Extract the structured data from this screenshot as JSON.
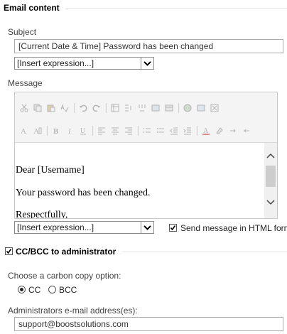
{
  "email_content": {
    "heading": "Email content",
    "subject_label": "Subject",
    "subject_value": "[Current Date & Time] Password has been changed",
    "subject_expression": "[Insert expression...]",
    "message_label": "Message",
    "toolbar_icons": [
      "cut-icon",
      "copy-icon",
      "paste-icon",
      "spellcheck-icon",
      "undo-icon",
      "redo-icon",
      "table-icon",
      "insert-rows-icon",
      "insert-columns-icon",
      "table-properties-icon",
      "cell-properties-icon",
      "image-icon",
      "link-icon",
      "html-source-icon",
      "font-size-icon",
      "font-style-icon",
      "bold-icon",
      "italic-icon",
      "underline-icon",
      "align-left-icon",
      "align-center-icon",
      "align-right-icon",
      "numbered-list-icon",
      "bullet-list-icon",
      "decrease-indent-icon",
      "increase-indent-icon",
      "text-color-icon",
      "highlight-icon",
      "left-to-right-icon",
      "right-to-left-icon"
    ],
    "message_lines": [
      "Dear [Username]",
      "Your password has been changed.",
      "Respectfully,"
    ],
    "message_expression": "[Insert expression...]",
    "html_checkbox_label": "Send message in HTML format",
    "html_checked": true
  },
  "ccbcc": {
    "heading": "CC/BCC to administrator",
    "checked": true,
    "carbon_copy_label": "Choose a carbon copy option:",
    "options": [
      "CC",
      "BCC"
    ],
    "selected_option": "CC",
    "admin_label": "Administrators e-mail address(es):",
    "admin_value": "support@boostsolutions.com"
  }
}
